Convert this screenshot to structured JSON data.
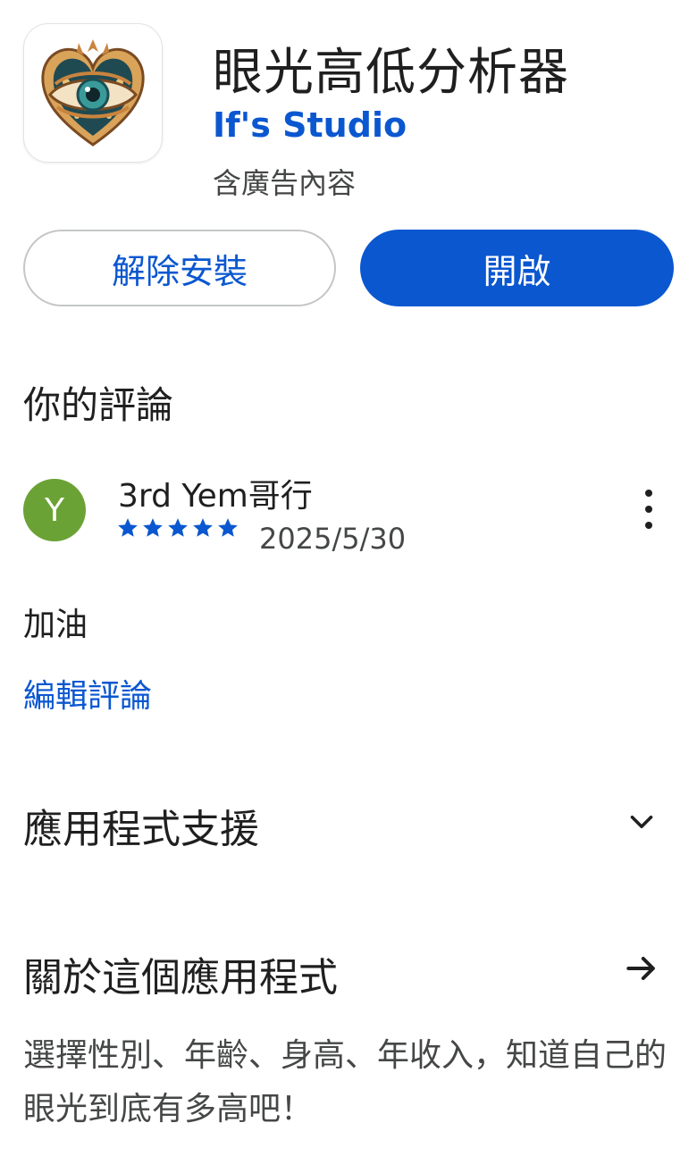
{
  "app": {
    "title": "眼光高低分析器",
    "developer": "If's Studio",
    "ads_note": "含廣告內容",
    "icon": "eye-heart-icon"
  },
  "actions": {
    "uninstall_label": "解除安裝",
    "open_label": "開啟"
  },
  "review_section": {
    "title": "你的評論",
    "reviewer": {
      "avatar_letter": "Y",
      "avatar_color": "#6ba236",
      "name": "3rd Yem哥行"
    },
    "rating": 5,
    "rating_max": 5,
    "date": "2025/5/30",
    "text": "加油",
    "edit_label": "編輯評論",
    "more_icon": "more-vert-icon"
  },
  "support": {
    "title": "應用程式支援",
    "icon": "chevron-down-icon"
  },
  "about": {
    "title": "關於這個應用程式",
    "icon": "arrow-right-icon",
    "description": "選擇性別、年齡、身高、年收入，知道自己的眼光到底有多高吧！"
  },
  "colors": {
    "accent": "#0b57d0",
    "text": "#1f1f1f",
    "secondary_text": "#444746",
    "star": "#0b57d0",
    "outline": "#c4c7c5"
  }
}
